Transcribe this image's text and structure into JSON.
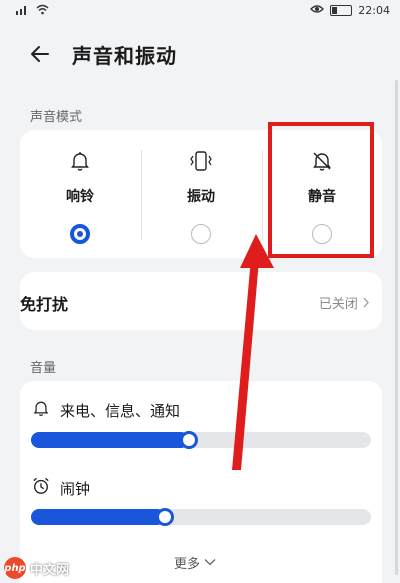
{
  "status_bar": {
    "time": "22:04"
  },
  "header": {
    "title": "声音和振动"
  },
  "sound_mode": {
    "section_label": "声音模式",
    "modes": [
      {
        "label": "响铃",
        "icon": "bell-icon",
        "selected": true
      },
      {
        "label": "振动",
        "icon": "vibrate-icon",
        "selected": false
      },
      {
        "label": "静音",
        "icon": "bell-off-icon",
        "selected": false
      }
    ]
  },
  "dnd": {
    "label": "免打扰",
    "value": "已关闭"
  },
  "volume": {
    "section_label": "音量",
    "items": [
      {
        "label": "来电、信息、通知",
        "icon": "bell-icon",
        "level": 0.44
      },
      {
        "label": "闹钟",
        "icon": "alarm-icon",
        "level": 0.37
      }
    ],
    "more_label": "更多"
  },
  "watermark": {
    "logo": "php",
    "text": "中文网"
  },
  "colors": {
    "accent": "#1a56db",
    "annotation": "#e01d1d",
    "background": "#f1f3f5"
  }
}
